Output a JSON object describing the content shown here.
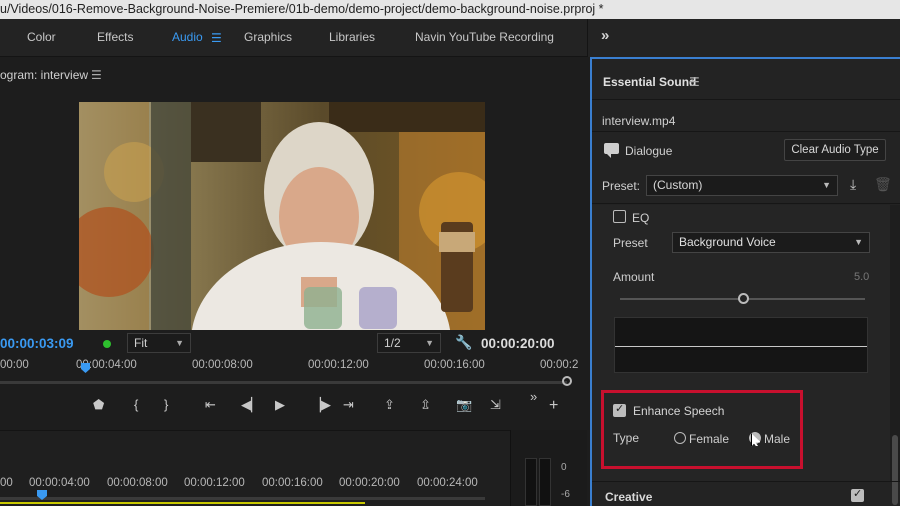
{
  "window": {
    "title": "u/Videos/016-Remove-Background-Noise-Premiere/01b-demo/demo-project/demo-background-noise.prproj *"
  },
  "workspaces": {
    "tabs": [
      "Color",
      "Effects",
      "Audio",
      "Graphics",
      "Libraries",
      "Navin YouTube Recording"
    ],
    "active": "Audio",
    "menu_glyph": "☰",
    "expand_glyph": "»"
  },
  "program": {
    "title": "ogram: interview",
    "menu_glyph": "☰",
    "timecode_current": "00:00:03:09",
    "fit_label": "Fit",
    "resolution_label": "1/2",
    "timecode_duration": "00:00:20:00",
    "ruler_labels": [
      "00:00",
      "00:00:04:00",
      "00:00:08:00",
      "00:00:12:00",
      "00:00:16:00",
      "00:00:2"
    ]
  },
  "transport": {
    "buttons": [
      "marker",
      "in-point",
      "out-point",
      "go-to-in",
      "step-back",
      "play",
      "step-forward",
      "go-to-out",
      "lift",
      "extract",
      "export-frame",
      "insert",
      "more",
      "add"
    ]
  },
  "timeline": {
    "ruler_labels": [
      "00",
      "00:00:04:00",
      "00:00:08:00",
      "00:00:12:00",
      "00:00:16:00",
      "00:00:20:00",
      "00:00:24:00"
    ],
    "meter_labels": [
      "0",
      "-6"
    ]
  },
  "essential_sound": {
    "title": "Essential Sound",
    "menu_glyph": "☰",
    "clip_name": "interview.mp4",
    "audio_type": "Dialogue",
    "clear_button": "Clear Audio Type",
    "preset_label": "Preset:",
    "preset_value": "(Custom)",
    "eq": {
      "label": "EQ",
      "checked": false,
      "preset_label": "Preset",
      "preset_value": "Background Voice",
      "amount_label": "Amount",
      "amount_value": "5.0",
      "amount_level": 0.5
    },
    "enhance_speech": {
      "label": "Enhance Speech",
      "checked": true,
      "type_label": "Type",
      "options": [
        "Female",
        "Male"
      ],
      "selected": "Male"
    },
    "creative": {
      "label": "Creative",
      "checked": true
    }
  },
  "colors": {
    "accent_blue": "#3a9af2",
    "highlight_red": "#c8102e",
    "panel_border": "#3a7fd0"
  }
}
